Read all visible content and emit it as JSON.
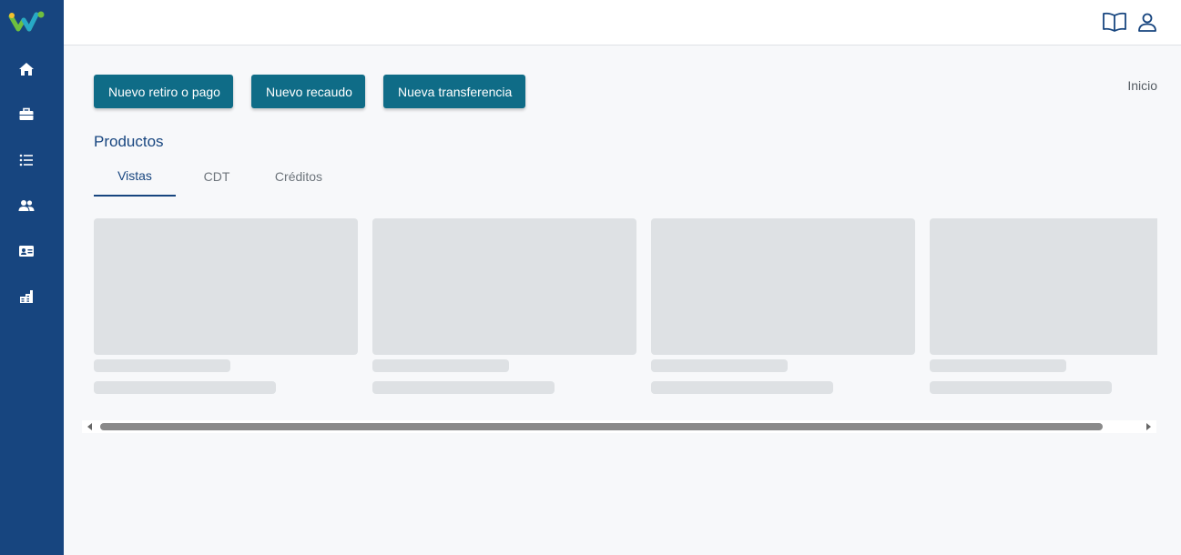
{
  "sidebar": {
    "logo": "app-logo",
    "items": [
      {
        "icon": "home-icon"
      },
      {
        "icon": "briefcase-icon"
      },
      {
        "icon": "list-icon"
      },
      {
        "icon": "users-icon"
      },
      {
        "icon": "id-card-icon"
      },
      {
        "icon": "building-icon"
      }
    ]
  },
  "header": {
    "icons": [
      "book-icon",
      "user-icon"
    ]
  },
  "actions": {
    "withdraw_label": "Nuevo retiro o pago",
    "collection_label": "Nuevo recaudo",
    "transfer_label": "Nueva transferencia"
  },
  "breadcrumb": {
    "current": "Inicio"
  },
  "products": {
    "title": "Productos",
    "tabs": [
      {
        "label": "Vistas",
        "active": true
      },
      {
        "label": "CDT",
        "active": false
      },
      {
        "label": "Créditos",
        "active": false
      }
    ]
  },
  "colors": {
    "sidebar": "#17457f",
    "button": "#0f6c87",
    "skeleton": "#dee1e4",
    "accent": "#17457f"
  }
}
